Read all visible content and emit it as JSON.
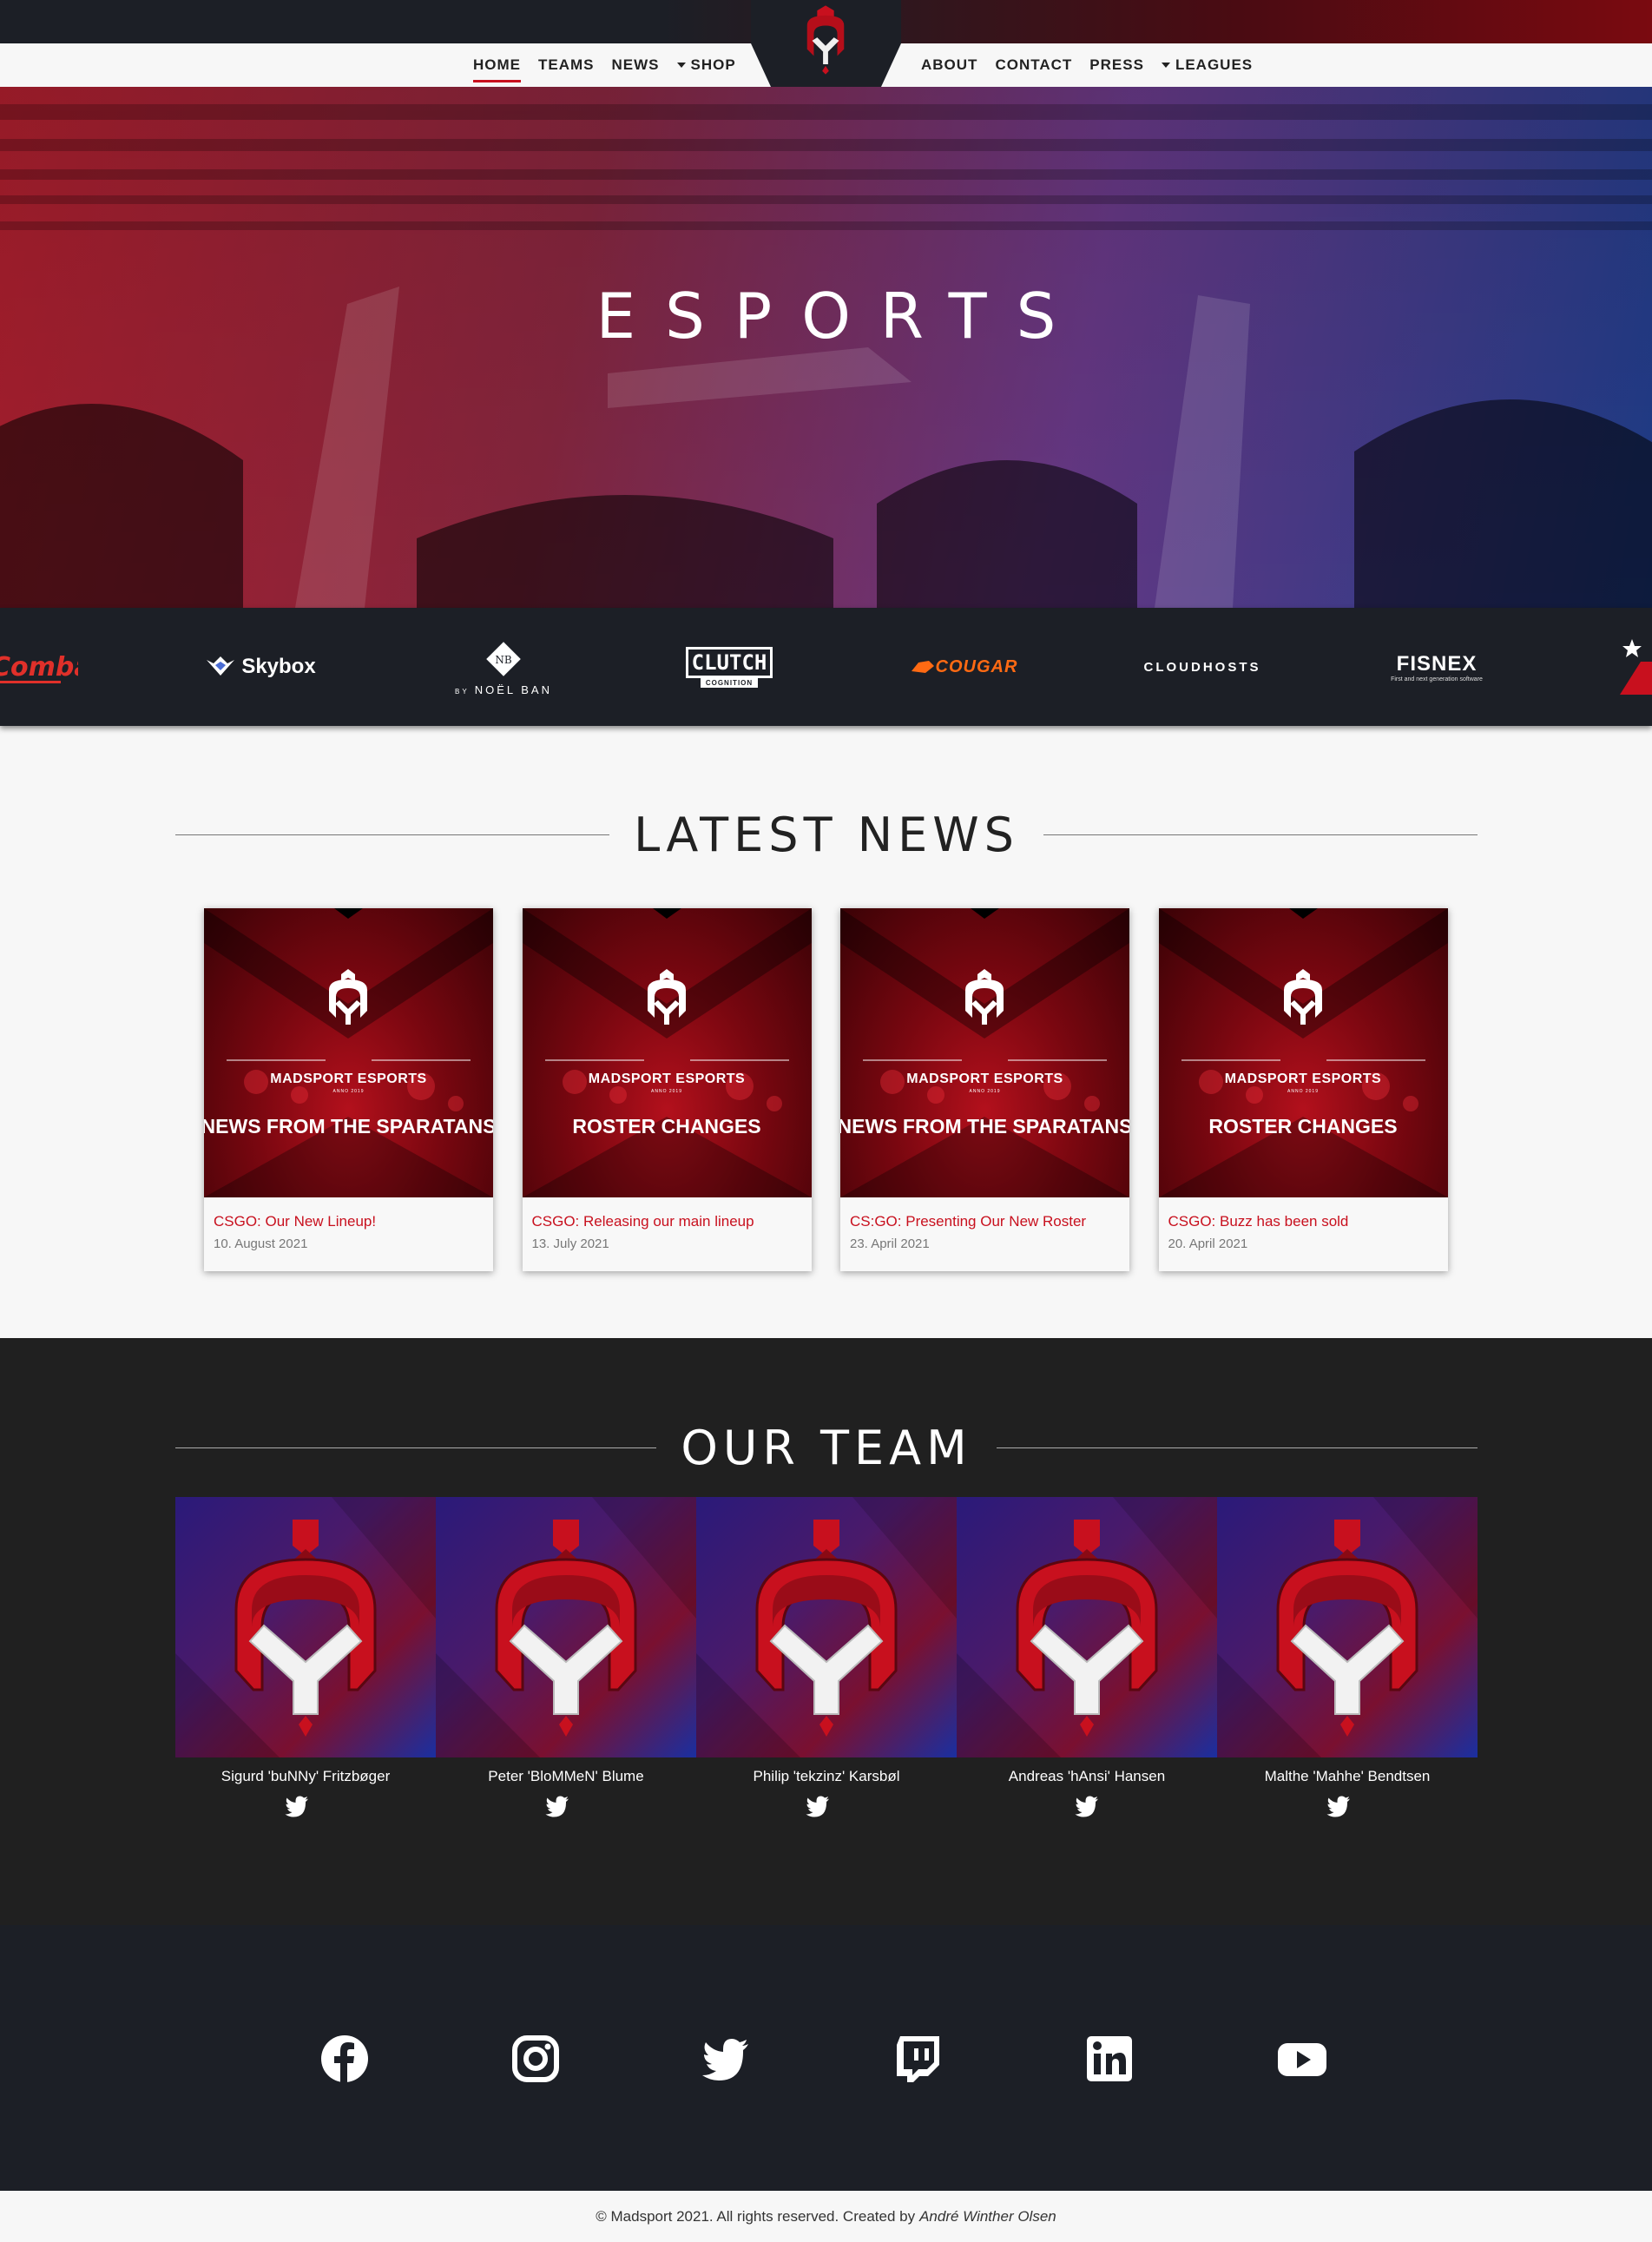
{
  "nav": {
    "left": [
      {
        "label": "HOME",
        "active": true
      },
      {
        "label": "TEAMS"
      },
      {
        "label": "NEWS"
      },
      {
        "label": "SHOP",
        "dropdown": true
      }
    ],
    "right": [
      {
        "label": "ABOUT"
      },
      {
        "label": "CONTACT"
      },
      {
        "label": "PRESS"
      },
      {
        "label": "LEAGUES",
        "dropdown": true
      }
    ],
    "logo_icon": "madsport-spartan-helmet-logo"
  },
  "hero": {
    "title": "ESPORTS"
  },
  "sponsors": [
    {
      "name": "Combat",
      "label": "Combat",
      "icon": "combat-logo"
    },
    {
      "name": "Skybox",
      "label": "Skybox",
      "icon": "skybox-logo"
    },
    {
      "name": "Noël Ban",
      "label": "NOËL BAN",
      "prefix": "BY",
      "icon": "noel-ban-logo"
    },
    {
      "name": "Clutch Cognition",
      "label": "CLUTCH",
      "sublabel": "COGNITION",
      "icon": "clutch-logo"
    },
    {
      "name": "Cougar",
      "label": "COUGAR",
      "icon": "cougar-logo"
    },
    {
      "name": "Cloudhosts",
      "label": "CLOUDHOSTS",
      "icon": "cloudhosts-logo"
    },
    {
      "name": "Fisnex",
      "label": "FISNEX",
      "sublabel": "First and next generation software",
      "icon": "fisnex-logo"
    }
  ],
  "news": {
    "heading": "LATEST NEWS",
    "items": [
      {
        "banner_brand": "MADSPORT ESPORTS",
        "banner_sub": "ANNO 2019",
        "banner_title": "NEWS FROM THE SPARATANS",
        "title": "CSGO: Our New Lineup!",
        "date": "10. August 2021"
      },
      {
        "banner_brand": "MADSPORT ESPORTS",
        "banner_sub": "ANNO 2019",
        "banner_title": "ROSTER CHANGES",
        "title": "CSGO: Releasing our main lineup",
        "date": "13. July 2021"
      },
      {
        "banner_brand": "MADSPORT ESPORTS",
        "banner_sub": "ANNO 2019",
        "banner_title": "NEWS FROM THE SPARATANS",
        "title": "CS:GO: Presenting Our New Roster",
        "date": "23. April 2021"
      },
      {
        "banner_brand": "MADSPORT ESPORTS",
        "banner_sub": "ANNO 2019",
        "banner_title": "ROSTER CHANGES",
        "title": "CSGO: Buzz has been sold",
        "date": "20. April 2021"
      }
    ]
  },
  "team": {
    "heading": "OUR TEAM",
    "members": [
      {
        "name": "Sigurd 'buNNy' Fritzbøger",
        "social_icon": "twitter-icon"
      },
      {
        "name": "Peter 'BloMMeN' Blume",
        "social_icon": "twitter-icon"
      },
      {
        "name": "Philip 'tekzinz' Karsbøl",
        "social_icon": "twitter-icon"
      },
      {
        "name": "Andreas 'hAnsi' Hansen",
        "social_icon": "twitter-icon"
      },
      {
        "name": "Malthe 'Mahhe' Bendtsen",
        "social_icon": "twitter-icon"
      }
    ]
  },
  "social": [
    "facebook-icon",
    "instagram-icon",
    "twitter-icon",
    "twitch-icon",
    "linkedin-icon",
    "youtube-icon"
  ],
  "footer": {
    "copyright": "© Madsport 2021. All rights reserved. Created by",
    "author": "André Winther Olsen"
  },
  "colors": {
    "accent_red": "#c8101e",
    "dark": "#1c1f26",
    "team_bg": "#202020"
  }
}
